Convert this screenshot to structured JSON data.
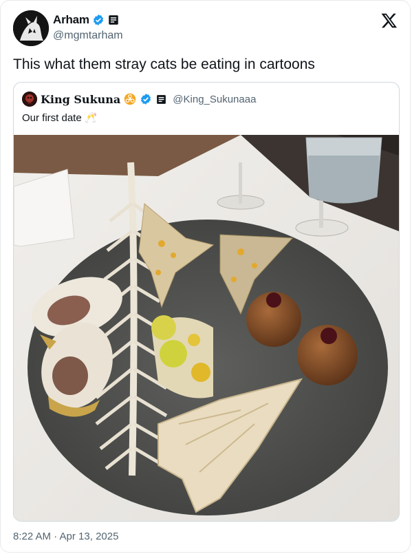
{
  "tweet": {
    "display_name": "Arham",
    "handle": "@mgmtarham",
    "text": "This what them stray cats be eating in cartoons",
    "timestamp": "8:22 AM · Apr 13, 2025"
  },
  "quote": {
    "display_name": "King Sukuna",
    "handle": "@King_Sukunaaa",
    "text": "Our first date",
    "emoji": "🥂"
  },
  "icons": {
    "verified": "verified-badge-icon",
    "affiliation": "affiliation-badge-icon",
    "biohazard": "biohazard-emoji-icon",
    "brand": "x-logo-icon"
  },
  "colors": {
    "verified_blue": "#1d9bf0",
    "text_primary": "#0f1419",
    "text_secondary": "#536471",
    "border": "#cfd9de"
  }
}
